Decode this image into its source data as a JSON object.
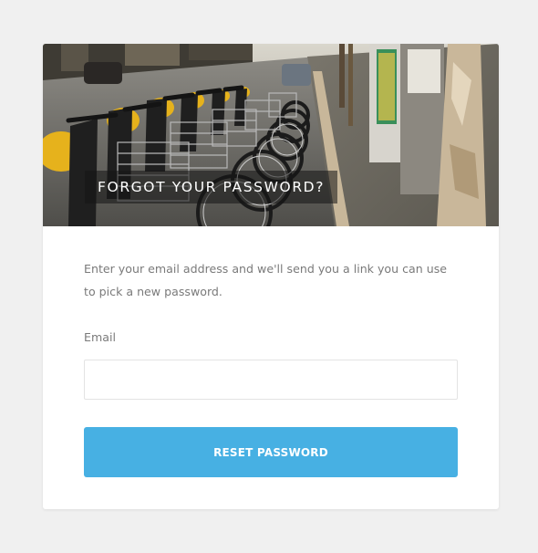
{
  "page": {
    "background": "#f0f0f0"
  },
  "hero": {
    "title": "FORGOT YOUR PASSWORD?",
    "image": "city-street-bike-share-photo"
  },
  "form": {
    "intro": "Enter your email address and we'll send you a link you can use to pick a new password.",
    "email_label": "Email",
    "email_value": "",
    "email_placeholder": "",
    "submit_label": "RESET PASSWORD"
  },
  "colors": {
    "accent": "#47b0e3",
    "card": "#ffffff",
    "text_muted": "#7a7a7a"
  }
}
